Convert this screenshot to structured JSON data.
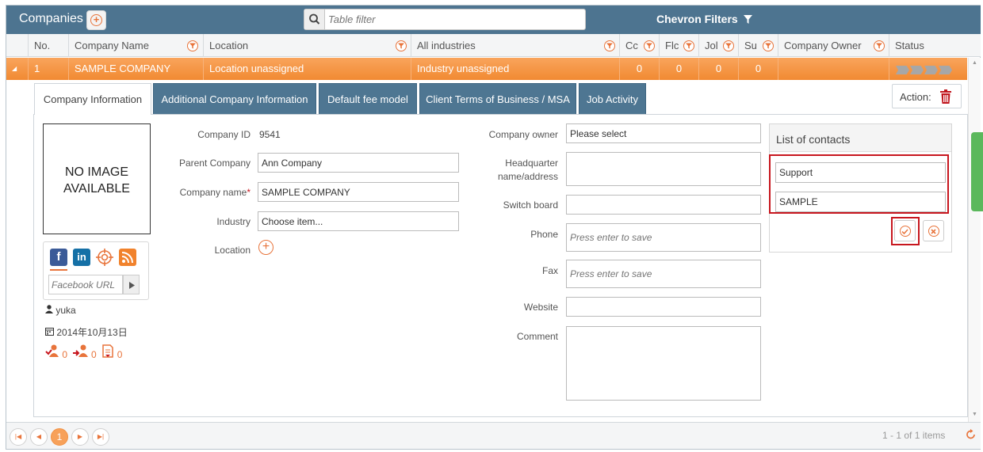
{
  "header": {
    "title": "Companies",
    "filter_placeholder": "Table filter",
    "chevron_filters": "Chevron Filters"
  },
  "columns": [
    "No.",
    "Company Name",
    "Location",
    "All industries",
    "Cc",
    "Flc",
    "Jol",
    "Su",
    "Company Owner",
    "Status"
  ],
  "row": {
    "expand": "◢",
    "no": "1",
    "company_name": "SAMPLE COMPANY",
    "location": "Location unassigned",
    "industry": "Industry unassigned",
    "cc": "0",
    "fl": "0",
    "jo": "0",
    "su": "0",
    "status_steps": 4
  },
  "tabs": [
    "Company Information",
    "Additional Company Information",
    "Default fee model",
    "Client Terms of Business / MSA",
    "Job Activity"
  ],
  "action_label": "Action:",
  "no_image": {
    "line1": "NO IMAGE",
    "line2": "AVAILABLE"
  },
  "social": {
    "facebook": "f",
    "linkedin": "in",
    "facebook_url_placeholder": "Facebook URL"
  },
  "meta": {
    "user": "yuka",
    "date": "2014年10月13日",
    "count1": "0",
    "count2": "0",
    "count3": "0"
  },
  "form_left": {
    "company_id_label": "Company ID",
    "company_id_value": "9541",
    "parent_company_label": "Parent Company",
    "parent_company_value": "Ann Company",
    "company_name_label": "Company name",
    "required_mark": "*",
    "company_name_value": "SAMPLE COMPANY",
    "industry_label": "Industry",
    "industry_value": "Choose item...",
    "location_label": "Location"
  },
  "form_right": {
    "owner_label": "Company owner",
    "owner_value": "Please select",
    "hq_label_1": "Headquarter",
    "hq_label_2": "name/address",
    "switchboard_label": "Switch board",
    "phone_label": "Phone",
    "phone_placeholder": "Press enter to save",
    "fax_label": "Fax",
    "fax_placeholder": "Press enter to save",
    "website_label": "Website",
    "comment_label": "Comment"
  },
  "contacts": {
    "title": "List of contacts",
    "field1": "Support",
    "field2": "SAMPLE"
  },
  "pager": {
    "current": "1",
    "info": "1 - 1 of 1 items"
  },
  "colors": {
    "accent": "#e8743b",
    "header": "#4d7490",
    "selected_row": "#f49a4c"
  }
}
